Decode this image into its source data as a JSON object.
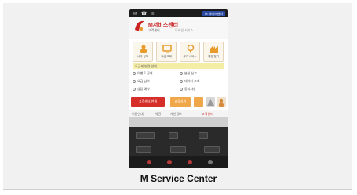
{
  "caption": "M Service Center",
  "phone": {
    "status_icons": "✉ ☎ ≡",
    "notice": "M 서비스센터",
    "brand": "M서비스센터",
    "brand_sub": "고객센터",
    "brand_desc": "모바일 서비스",
    "tiles": [
      {
        "label": "나의 정보",
        "icon": "person-icon",
        "color": "#e89a2a"
      },
      {
        "label": "요금 조회",
        "icon": "monitor-icon",
        "color": "#e89a2a"
      },
      {
        "label": "부가 서비스",
        "icon": "bulb-icon",
        "color": "#e89a2a"
      },
      {
        "label": "매장 찾기",
        "icon": "building-icon",
        "color": "#e89a2a"
      }
    ],
    "yellow_bar": "요금제 변경 안내",
    "menu": [
      "이벤트 참여",
      "분실 신고",
      "요금 납부",
      "데이터 조회",
      "상담 예약",
      "공지사항"
    ],
    "btn_red": "고객센터 연결",
    "btn_orange": "바로가기",
    "links": [
      "이용안내",
      "약관",
      "개인정보",
      "고객센터"
    ]
  },
  "colors": {
    "accent_red": "#d62f2a",
    "accent_orange": "#f0a74a",
    "brand_red": "#c92020"
  }
}
